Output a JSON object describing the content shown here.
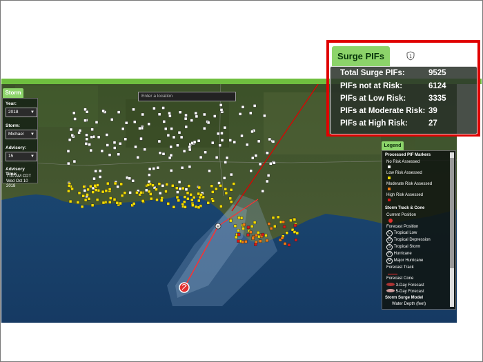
{
  "storm_panel": {
    "tab_label": "Storm",
    "year_label": "Year:",
    "year_value": "2018",
    "storm_label": "Storm:",
    "storm_value": "Michael",
    "advisory_label": "Advisory:",
    "advisory_value": "15",
    "advisory_time_label": "Advisory Time:",
    "advisory_time_value": "7:00 AM CDT Wed Oct 10 2018"
  },
  "search": {
    "placeholder": "Enter a location"
  },
  "legend": {
    "tab_label": "Legend",
    "pif_header": "Processed PIF Markers",
    "pif_items": [
      "No Risk Assessed",
      "Low Risk Assessed",
      "Moderate Risk Assessed",
      "High Risk Assessed"
    ],
    "track_header": "Storm Track & Cone",
    "current_position": "Current Position",
    "forecast_position": "Forecast Position",
    "position_items": [
      {
        "symbol": "L",
        "label": "Tropical Low"
      },
      {
        "symbol": "D",
        "label": "Tropical Depression"
      },
      {
        "symbol": "S",
        "label": "Tropical Storm"
      },
      {
        "symbol": "H",
        "label": "Hurricane"
      },
      {
        "symbol": "M",
        "label": "Major Hurricane"
      }
    ],
    "forecast_track": "Forecast Track",
    "forecast_cone": "Forecast Cone",
    "cone_items": [
      "3-Day Forecast",
      "5-Day Forecast"
    ],
    "surge_header": "Storm Surge Model",
    "surge_sub": "Water Depth (feet)"
  },
  "surge_pifs": {
    "tab_label": "Surge PIFs",
    "badge_icon": "shield-icon",
    "stats": [
      {
        "label": "Total Surge PIFs:",
        "value": "9525"
      },
      {
        "label": "PIFs not at Risk:",
        "value": "6124"
      },
      {
        "label": "PIFs at Low Risk:",
        "value": "3335"
      },
      {
        "label": "PIFs at Moderate Risk:",
        "value": "39"
      },
      {
        "label": "PIFs at High Risk:",
        "value": "27"
      }
    ]
  },
  "colors": {
    "accent_green": "#8cd46a",
    "callout_red": "#e00000",
    "low_risk": "#f2dc00",
    "moderate_risk": "#f07a12",
    "high_risk": "#d81818",
    "no_risk": "#ffffff"
  }
}
